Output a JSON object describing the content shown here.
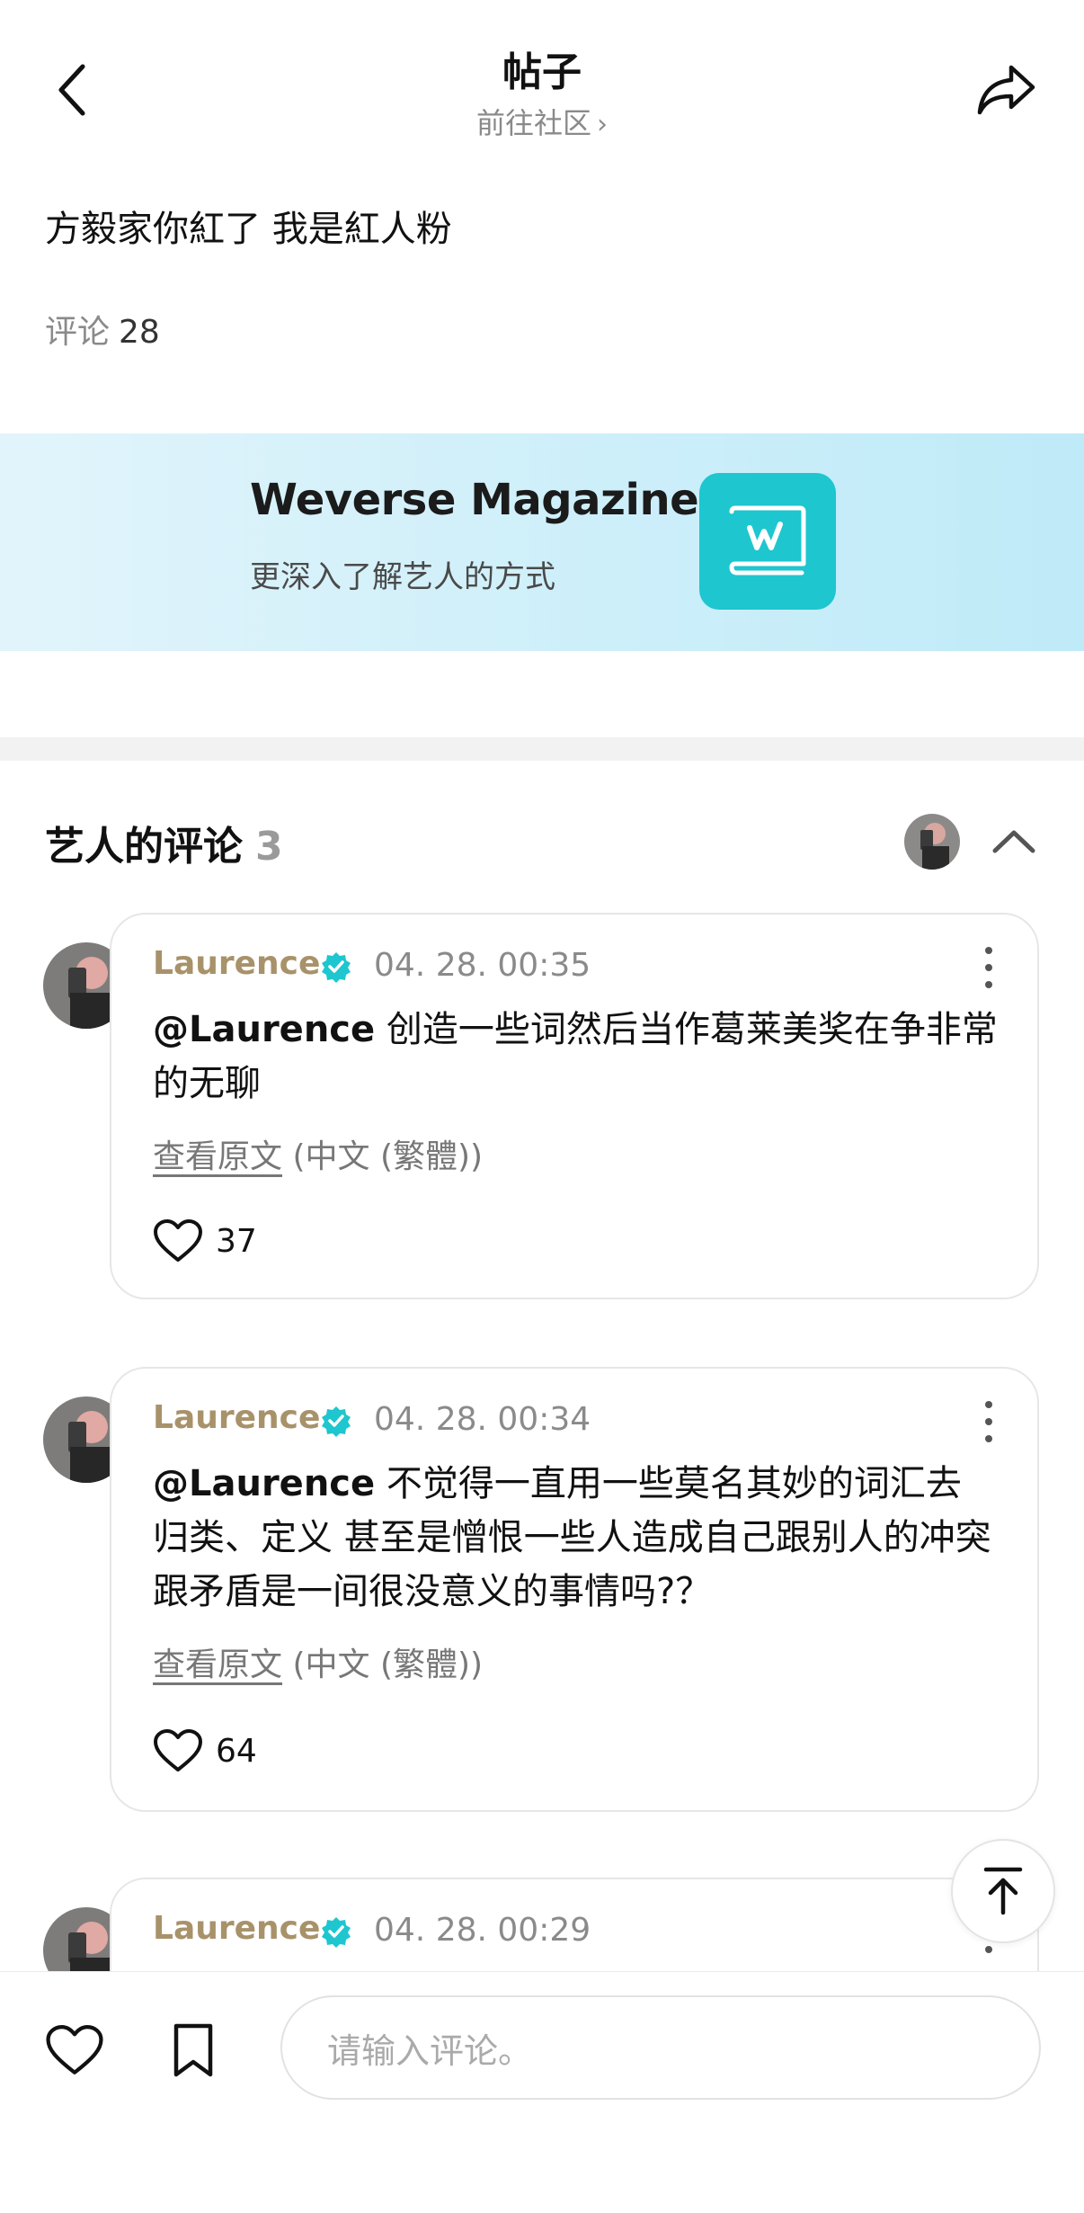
{
  "header": {
    "title": "帖子",
    "community_link": "前往社区",
    "back_icon": "chevron-left-icon",
    "share_icon": "share-arrow-icon"
  },
  "post": {
    "text": "方毅家你紅了 我是紅人粉",
    "comment_label": "评论",
    "comment_count": "28"
  },
  "banner": {
    "title": "Weverse Magazine",
    "subtitle": "更深入了解艺人的方式",
    "logo_icon": "weverse-magazine-logo",
    "logo_color": "#1ec6cf"
  },
  "artist_comments": {
    "heading": "艺人的评论",
    "count": "3",
    "collapse_icon": "chevron-up-icon"
  },
  "comments": [
    {
      "author": "Laurence",
      "time": "04. 28. 00:35",
      "mention": "@Laurence",
      "text": " 创造一些词然后当作葛莱美奖在争非常的无聊",
      "translate_link": "查看原文",
      "translate_lang": "(中文 (繁體))",
      "likes": "37"
    },
    {
      "author": "Laurence",
      "time": "04. 28. 00:34",
      "mention": "@Laurence",
      "text": " 不觉得一直用一些莫名其妙的词汇去 归类、定义 甚至是憎恨一些人造成自己跟别人的冲突跟矛盾是一间很没意义的事情吗?？",
      "translate_link": "查看原文",
      "translate_lang": "(中文 (繁體))",
      "likes": "64"
    },
    {
      "author": "Laurence",
      "time": "04. 28. 00:29"
    }
  ],
  "bottom_bar": {
    "input_placeholder": "请输入评论。",
    "like_icon": "heart-icon",
    "bookmark_icon": "bookmark-icon",
    "scroll_top_icon": "arrow-up-to-top-icon"
  },
  "colors": {
    "author_gold": "#a8926a",
    "verified_teal": "#1ec6cf",
    "muted_gray": "#8a8a8a"
  }
}
